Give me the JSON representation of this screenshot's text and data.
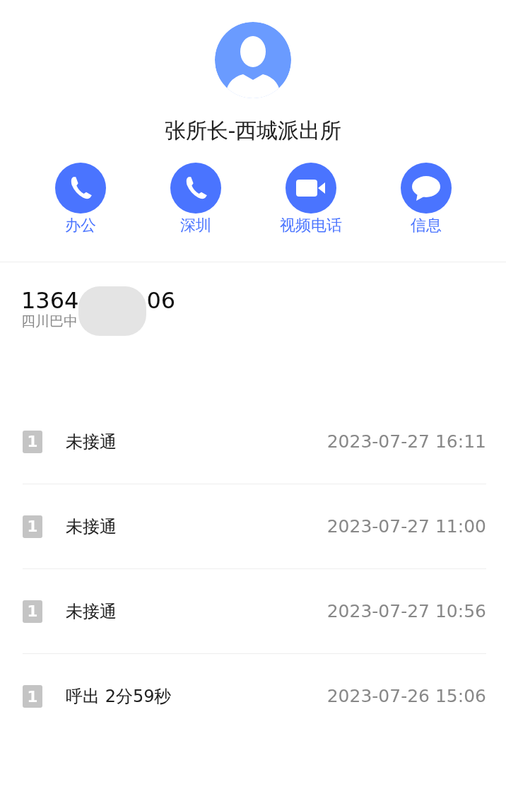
{
  "contact": {
    "name": "张所长-西城派出所"
  },
  "actions": [
    {
      "kind": "phone",
      "label": "办公"
    },
    {
      "kind": "phone",
      "label": "深圳"
    },
    {
      "kind": "video",
      "label": "视频电话"
    },
    {
      "kind": "message",
      "label": "信息"
    }
  ],
  "number": {
    "start": "1364",
    "end": "06",
    "location": "四川巴中"
  },
  "calls": [
    {
      "sim": "1",
      "status": "未接通",
      "time": "2023-07-27 16:11"
    },
    {
      "sim": "1",
      "status": "未接通",
      "time": "2023-07-27 11:00"
    },
    {
      "sim": "1",
      "status": "未接通",
      "time": "2023-07-27 10:56"
    },
    {
      "sim": "1",
      "status": "呼出 2分59秒",
      "time": "2023-07-26 15:06"
    }
  ]
}
